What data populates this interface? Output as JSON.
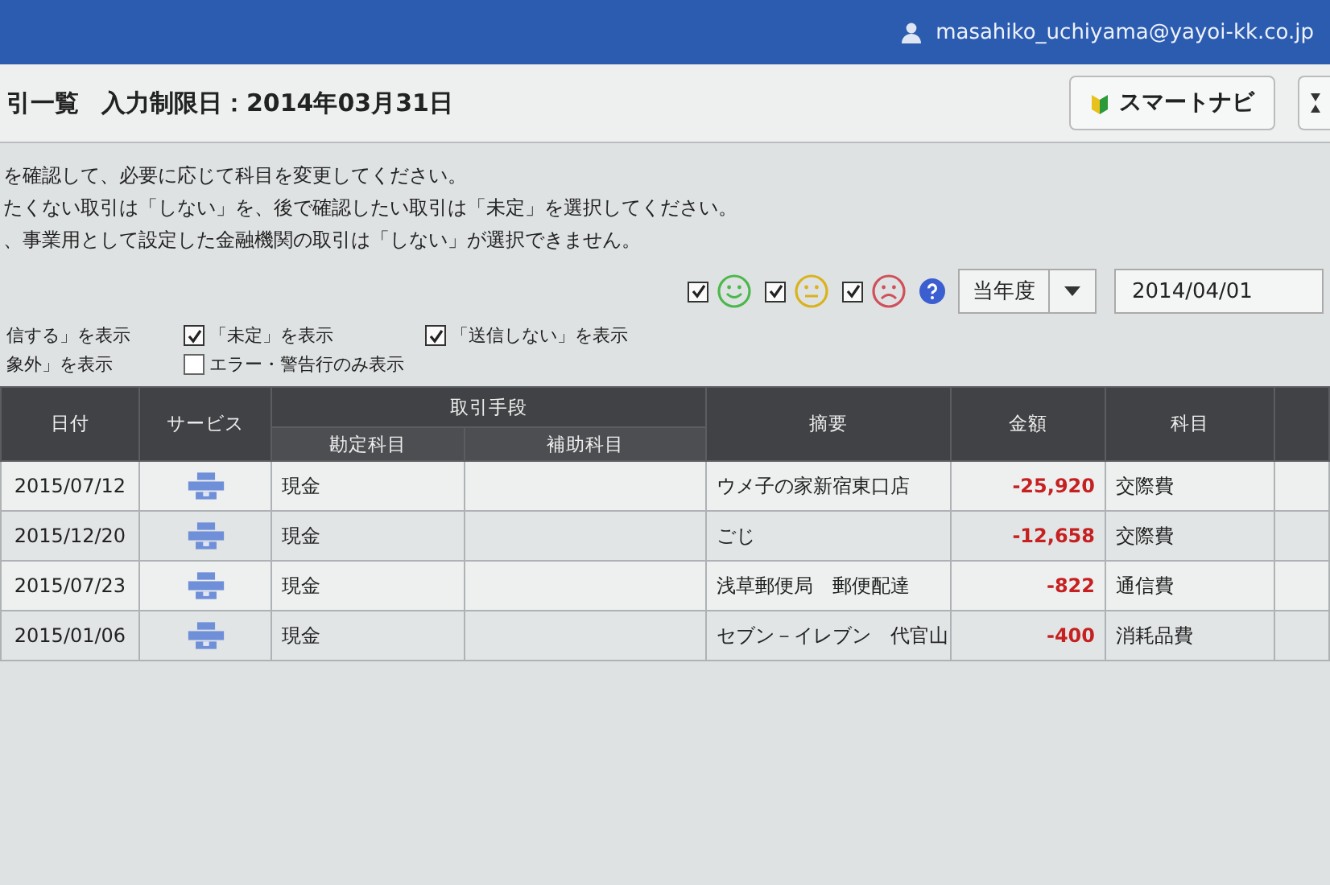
{
  "top_bar": {
    "user": "masahiko_uchiyama@yayoi-kk.co.jp"
  },
  "header": {
    "title": "引一覧",
    "deadline": "入力制限日：2014年03月31日",
    "smart_navi_button": "スマートナビ"
  },
  "instructions": [
    "を確認して、必要に応じて科目を変更してください。",
    "たくない取引は「しない」を、後で確認したい取引は「未定」を選択してください。",
    "、事業用として設定した金融機関の取引は「しない」が選択できません。"
  ],
  "mood_filters": [
    {
      "kind": "happy",
      "color": "#4cb84c",
      "checked": true
    },
    {
      "kind": "neutral",
      "color": "#d9b21c",
      "checked": true
    },
    {
      "kind": "sad",
      "color": "#d0505a",
      "checked": true
    }
  ],
  "period_select": {
    "value": "当年度"
  },
  "date_field": {
    "value": "2014/04/01"
  },
  "show_filters": [
    {
      "label": "信する」を表示"
    },
    {
      "label": "「未定」を表示",
      "checked": true
    },
    {
      "label": "「送信しない」を表示",
      "checked": true
    },
    {
      "label": "象外」を表示"
    },
    {
      "label": "エラー・警告行のみ表示",
      "checked": false
    }
  ],
  "table": {
    "columns": [
      "日付",
      "サービス",
      "取引手段",
      "勘定科目",
      "補助科目",
      "摘要",
      "金額",
      "科目"
    ],
    "rows": [
      {
        "date": "2015/07/12",
        "account": "現金",
        "description": "ウメ子の家新宿東口店",
        "amount": "-25,920",
        "category": "交際費"
      },
      {
        "date": "2015/12/20",
        "account": "現金",
        "description": "ごじ",
        "amount": "-12,658",
        "category": "交際費"
      },
      {
        "date": "2015/07/23",
        "account": "現金",
        "description": "浅草郵便局　郵便配達",
        "amount": "-822",
        "category": "通信費"
      },
      {
        "date": "2015/01/06",
        "account": "現金",
        "description": "セブン－イレブン　代官山",
        "amount": "-400",
        "category": "消耗品費"
      }
    ]
  }
}
